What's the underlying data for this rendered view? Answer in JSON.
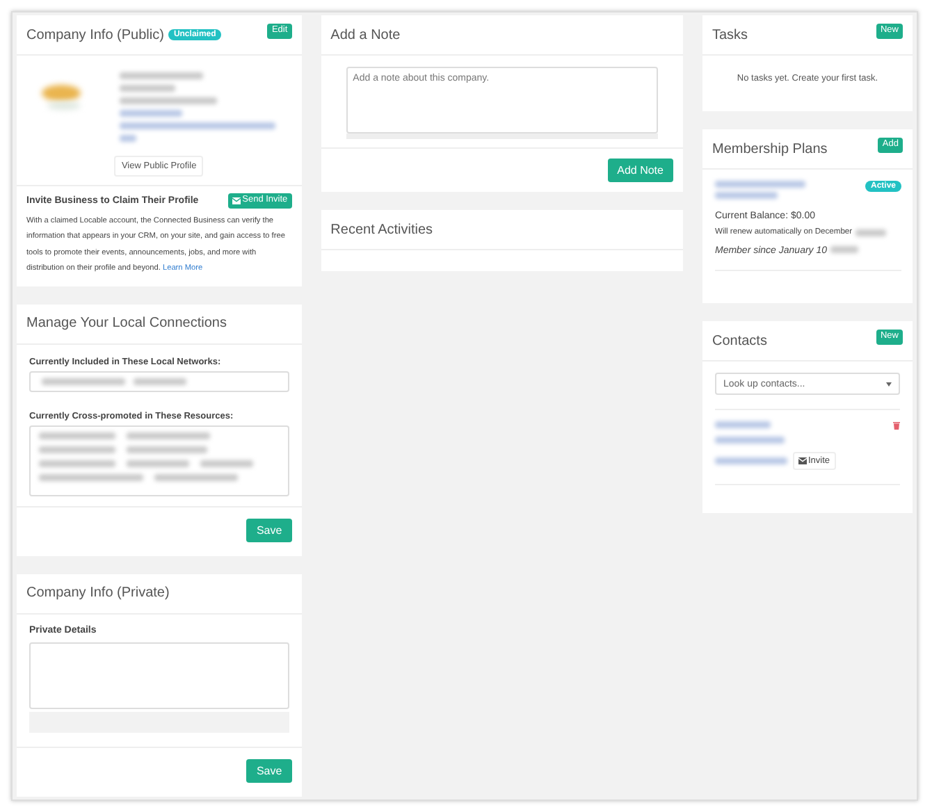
{
  "company_public": {
    "title": "Company Info (Public)",
    "badge": "Unclaimed",
    "action": "Edit",
    "profile_button": "View Public Profile",
    "invite": {
      "title": "Invite Business to Claim Their Profile",
      "button": "Send Invite",
      "text": "With a claimed Locable account, the Connected Business can verify the information that appears in your CRM, on your site, and gain access to free tools to promote their events, announcements, jobs, and more with distribution on their profile and beyond.",
      "link": "Learn More"
    }
  },
  "local_connections": {
    "title": "Manage Your Local Connections",
    "networks_label": "Currently Included in These Local Networks:",
    "resources_label": "Currently Cross-promoted in These Resources:",
    "button": "Save"
  },
  "company_private": {
    "title": "Company Info (Private)",
    "label": "Private Details",
    "button": "Save"
  },
  "note": {
    "title": "Add a Note",
    "placeholder": "Add a note about this company.",
    "button": "Add Note"
  },
  "recent": {
    "title": "Recent Activities"
  },
  "tasks": {
    "title": "Tasks",
    "action": "New",
    "empty": "No tasks yet. Create your first task."
  },
  "membership": {
    "title": "Membership Plans",
    "action": "Add",
    "status": "Active",
    "balance": "Current Balance: $0.00",
    "renew": "Will renew automatically on December",
    "since": "Member since January 10"
  },
  "contacts": {
    "title": "Contacts",
    "action": "New",
    "placeholder": "Look up contacts...",
    "invite_button": "Invite"
  }
}
